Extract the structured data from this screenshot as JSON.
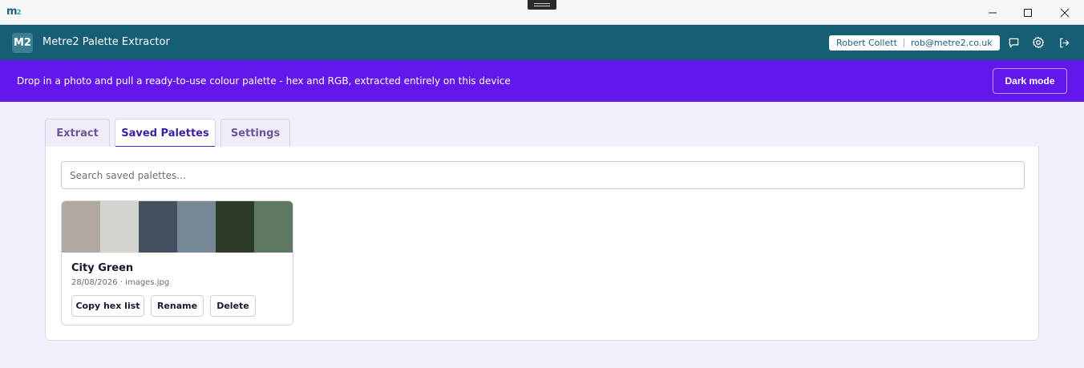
{
  "window": {
    "logo_main": "m",
    "logo_sub": "2"
  },
  "header": {
    "badge": "M2",
    "title": "Metre2 Palette Extractor",
    "user_name": "Robert Collett",
    "user_email": "rob@metre2.co.uk",
    "icons": [
      "message-icon",
      "gear-icon",
      "logout-icon"
    ]
  },
  "banner": {
    "text": "Drop in a photo and pull a ready-to-use colour palette - hex and RGB, extracted entirely on this device",
    "dark_mode_label": "Dark mode"
  },
  "tabs": [
    {
      "label": "Extract",
      "active": false
    },
    {
      "label": "Saved Palettes",
      "active": true
    },
    {
      "label": "Settings",
      "active": false
    }
  ],
  "saved": {
    "search_placeholder": "Search saved palettes...",
    "palettes": [
      {
        "name": "City Green",
        "meta": "28/08/2026 · images.jpg",
        "colors": [
          "#b2a8a2",
          "#d4d4cf",
          "#44505e",
          "#778795",
          "#2d3b29",
          "#5f7862"
        ],
        "actions": {
          "copy": "Copy hex list",
          "rename": "Rename",
          "delete": "Delete"
        }
      }
    ]
  },
  "colors": {
    "appbar": "#155e75",
    "banner": "#6317ea",
    "accent": "#5b1fdf",
    "background": "#f3f0fc"
  }
}
